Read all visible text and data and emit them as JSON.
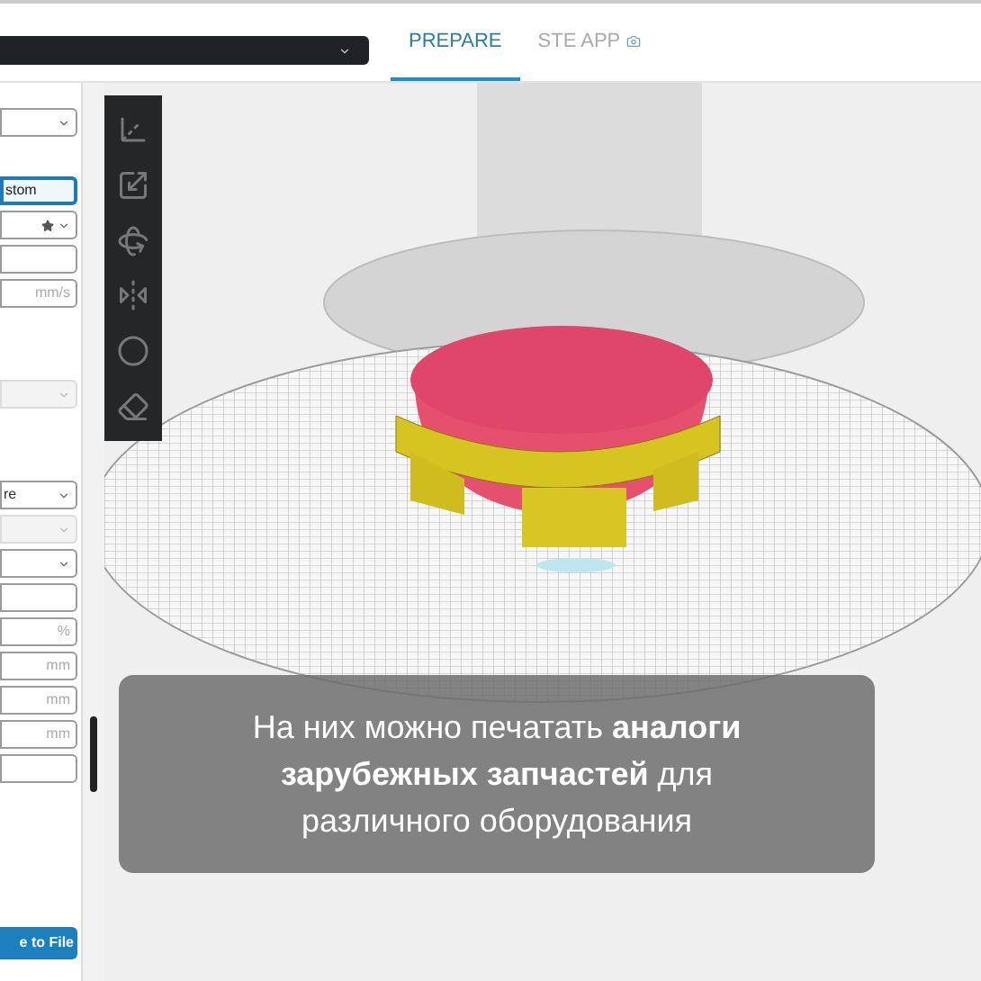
{
  "tabs": [
    {
      "label": "PREPARE",
      "selected": true
    },
    {
      "label": "STE APP",
      "selected": false
    }
  ],
  "settings": [
    [
      {
        "kind": "dropdown"
      },
      {
        "kind": "input",
        "value": "stom",
        "focused": true
      },
      {
        "kind": "dropdown",
        "starred": true
      },
      {
        "kind": "input"
      },
      {
        "kind": "input",
        "unit": "mm/s"
      }
    ],
    [
      {
        "kind": "dropdown",
        "disabled": true
      }
    ],
    [
      {
        "kind": "dropdown",
        "value": "re"
      },
      {
        "kind": "dropdown",
        "disabled": true
      },
      {
        "kind": "dropdown"
      },
      {
        "kind": "input"
      },
      {
        "kind": "input",
        "unit": "%"
      },
      {
        "kind": "input",
        "unit": "mm"
      },
      {
        "kind": "input",
        "unit": "mm"
      },
      {
        "kind": "input",
        "unit": "mm"
      },
      {
        "kind": "input"
      }
    ]
  ],
  "save_button": "e to File",
  "caption": "На них можно печатать **аналоги зарубежных запчастей** для различного оборудования"
}
